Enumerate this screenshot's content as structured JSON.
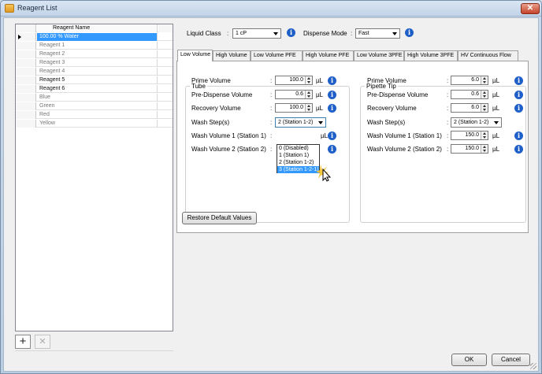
{
  "window": {
    "title": "Reagent List",
    "close_glyph": "✕"
  },
  "grid": {
    "header": "Reagent Name",
    "rows": [
      {
        "name": "100.00 % Water",
        "selected": true
      },
      {
        "name": "Reagent 1"
      },
      {
        "name": "Reagent 2"
      },
      {
        "name": "Reagent 3"
      },
      {
        "name": "Reagent 4"
      },
      {
        "name": "Reagent 5"
      },
      {
        "name": "Reagent 6"
      },
      {
        "name": "Blue"
      },
      {
        "name": "Green"
      },
      {
        "name": "Red"
      },
      {
        "name": "Yellow"
      }
    ]
  },
  "toolbar": {
    "add_glyph": "+",
    "delete_glyph": "✕"
  },
  "top": {
    "liquid_class_label": "Liquid Class",
    "liquid_class_value": "1 cP",
    "dispense_mode_label": "Dispense Mode",
    "dispense_mode_value": "Fast",
    "colon": ":",
    "info_glyph": "i"
  },
  "tabs": [
    "Low Volume",
    "High Volume",
    "Low Volume PFE",
    "High Volume PFE",
    "Low Volume 3PFE",
    "High Volume 3PFE",
    "HV Continuous Flow"
  ],
  "tube": {
    "title": "Tube",
    "prime_label": "Prime Volume",
    "prime_value": "100.0",
    "predispense_label": "Pre-Dispense Volume",
    "predispense_value": "0.6",
    "recovery_label": "Recovery Volume",
    "recovery_value": "100.0",
    "wash_steps_label": "Wash Step(s)",
    "wash_steps_value": "2 (Station 1-2)",
    "wash1_label": "Wash Volume 1 (Station 1)",
    "wash2_label": "Wash Volume 2 (Station 2)",
    "unit": "µL",
    "wash_options": [
      "0 (Disabled)",
      "1 (Station 1)",
      "2 (Station 1-2)",
      "3 (Station 1-2-1)"
    ]
  },
  "pipette": {
    "title": "Pipette Tip",
    "prime_label": "Prime Volume",
    "prime_value": "6.0",
    "predispense_label": "Pre-Dispense Volume",
    "predispense_value": "0.6",
    "recovery_label": "Recovery Volume",
    "recovery_value": "6.0",
    "wash_steps_label": "Wash Step(s)",
    "wash_steps_value": "2 (Station 1-2)",
    "wash1_label": "Wash Volume 1 (Station 1)",
    "wash1_value": "150.0",
    "wash2_label": "Wash Volume 2 (Station 2)",
    "wash2_value": "150.0",
    "unit": "µL"
  },
  "buttons": {
    "restore": "Restore Default Values",
    "ok": "OK",
    "cancel": "Cancel"
  }
}
